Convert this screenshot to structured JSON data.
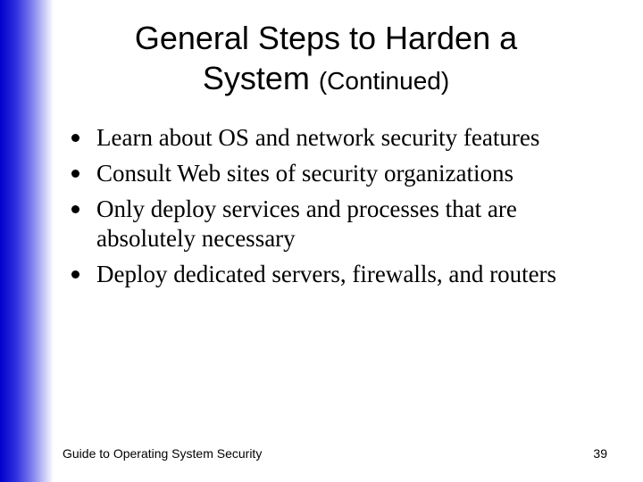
{
  "title_line1": "General Steps to Harden a",
  "title_line2_main": "System ",
  "title_line2_sub": "(Continued)",
  "bullets": [
    "Learn about OS and network security features",
    "Consult Web sites of security organizations",
    "Only deploy services and processes that are absolutely necessary",
    "Deploy dedicated servers, firewalls, and routers"
  ],
  "footer_left": "Guide to Operating System Security",
  "page_number": "39"
}
